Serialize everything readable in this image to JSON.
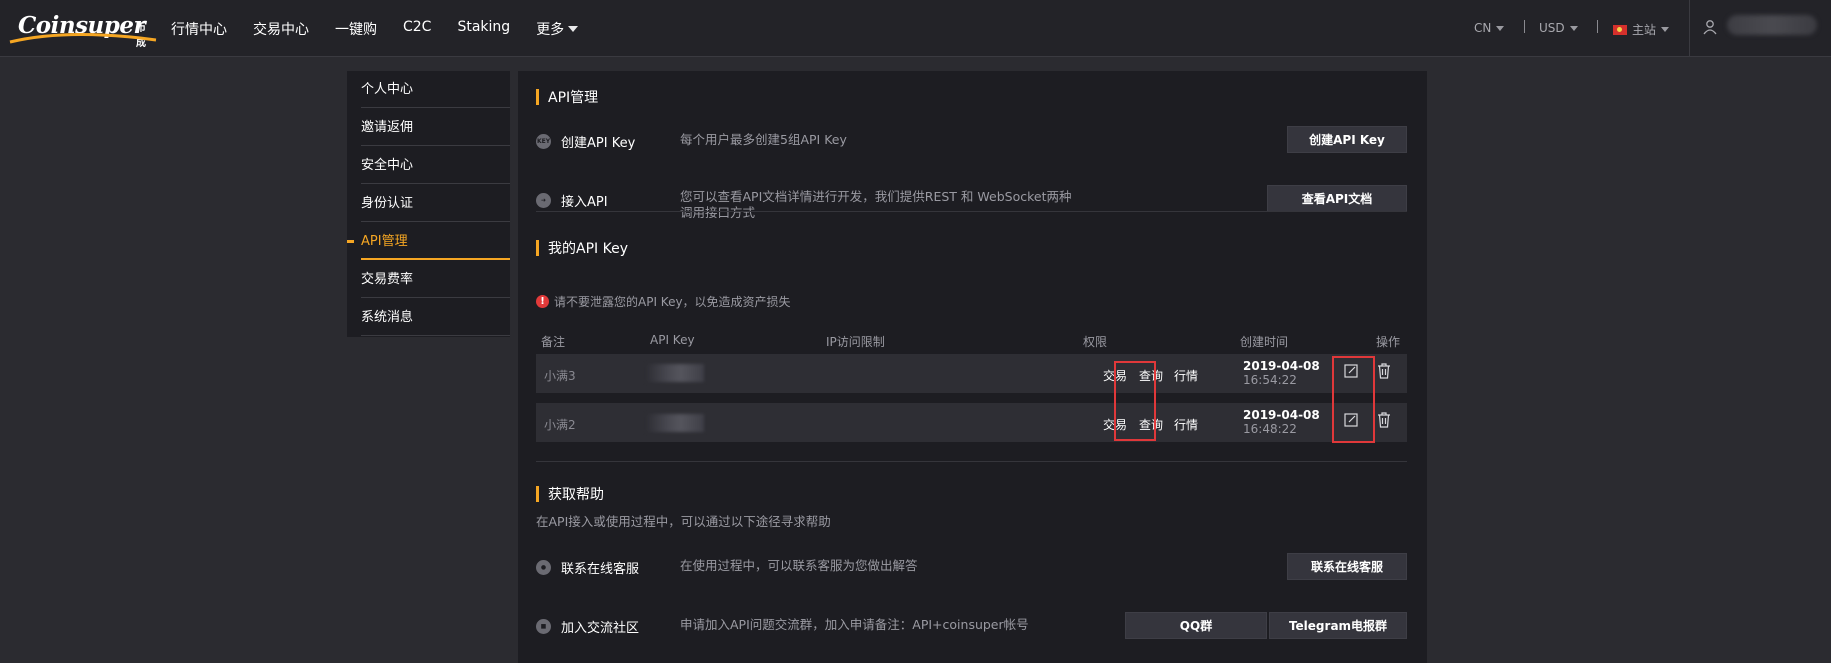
{
  "brand": {
    "logo_text": "Coinsuper",
    "logo_sub": "币成"
  },
  "nav": {
    "items": [
      "行情中心",
      "交易中心",
      "一键购",
      "C2C",
      "Staking"
    ],
    "more_label": "更多"
  },
  "header_right": {
    "language": "CN",
    "currency": "USD",
    "site": "主站"
  },
  "sidebar": {
    "items": [
      {
        "label": "个人中心"
      },
      {
        "label": "邀请返佣"
      },
      {
        "label": "安全中心"
      },
      {
        "label": "身份认证"
      },
      {
        "label": "API管理"
      },
      {
        "label": "交易费率"
      },
      {
        "label": "系统消息"
      }
    ],
    "active_index": 4
  },
  "api_section": {
    "title": "API管理",
    "create_label": "创建API Key",
    "create_desc": "每个用户最多创建5组API Key",
    "create_button": "创建API Key",
    "access_label": "接入API",
    "access_desc": "您可以查看API文档详情进行开发，我们提供REST 和 WebSocket两种调用接口方式",
    "access_button": "查看API文档"
  },
  "my_keys": {
    "title": "我的API Key",
    "warning": "请不要泄露您的API Key，以免造成资产损失",
    "columns": [
      "备注",
      "API Key",
      "IP访问限制",
      "权限",
      "创建时间",
      "操作"
    ],
    "rows": [
      {
        "note": "小满3",
        "perms": [
          "交易",
          "查询",
          "行情"
        ],
        "date": "2019-04-08",
        "time": "16:54:22"
      },
      {
        "note": "小满2",
        "perms": [
          "交易",
          "查询",
          "行情"
        ],
        "date": "2019-04-08",
        "time": "16:48:22"
      }
    ]
  },
  "help": {
    "title": "获取帮助",
    "subtitle": "在API接入或使用过程中，可以通过以下途径寻求帮助",
    "support_label": "联系在线客服",
    "support_desc": "在使用过程中，可以联系客服为您做出解答",
    "support_button": "联系在线客服",
    "community_label": "加入交流社区",
    "community_desc": "申请加入API问题交流群，加入申请备注：API+coinsuper帐号",
    "qq_button": "QQ群",
    "telegram_button": "Telegram电报群"
  },
  "colors": {
    "accent": "#f5a623",
    "highlight": "#e0383a",
    "panel": "#1d1d22",
    "background": "#2b2b30"
  }
}
